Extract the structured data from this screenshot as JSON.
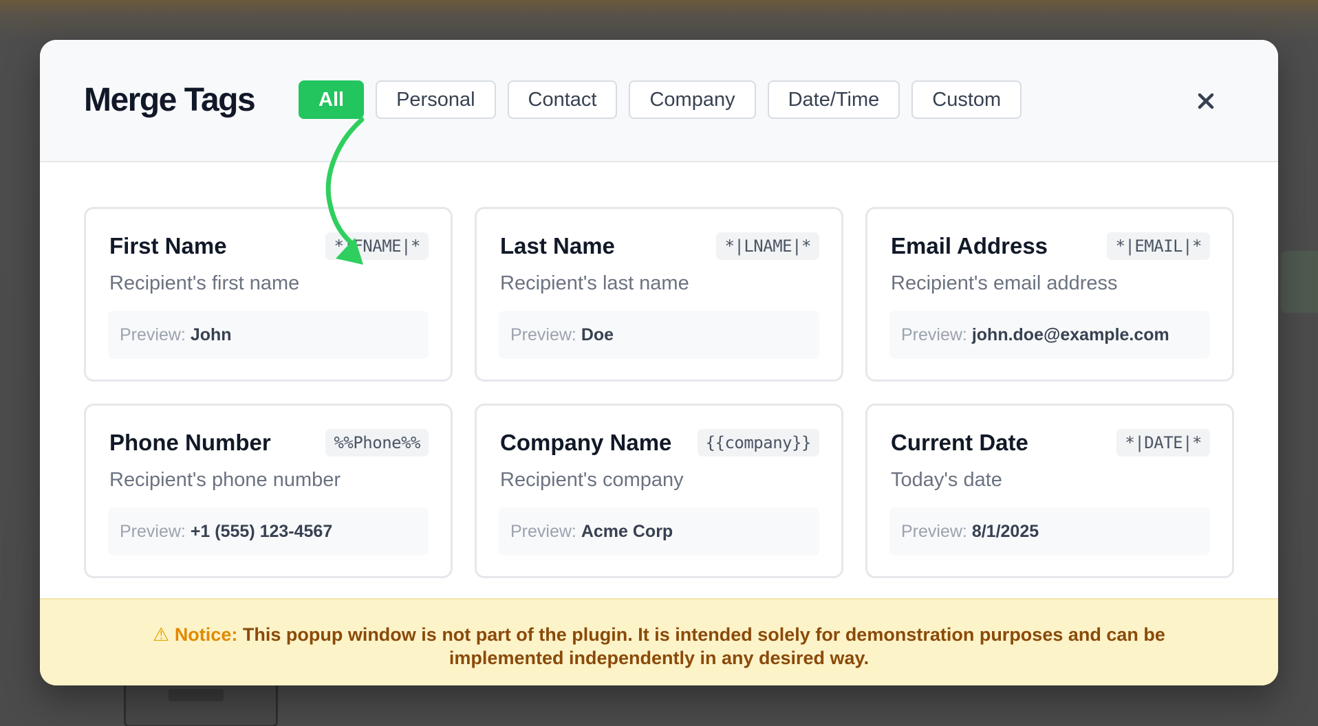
{
  "modal": {
    "title": "Merge Tags",
    "close_glyph": "×"
  },
  "tabs": [
    {
      "label": "All",
      "active": true
    },
    {
      "label": "Personal",
      "active": false
    },
    {
      "label": "Contact",
      "active": false
    },
    {
      "label": "Company",
      "active": false
    },
    {
      "label": "Date/Time",
      "active": false
    },
    {
      "label": "Custom",
      "active": false
    }
  ],
  "preview_label": "Preview:",
  "cards": [
    {
      "title": "First Name",
      "tag": "*|FNAME|*",
      "description": "Recipient's first name",
      "preview": "John"
    },
    {
      "title": "Last Name",
      "tag": "*|LNAME|*",
      "description": "Recipient's last name",
      "preview": "Doe"
    },
    {
      "title": "Email Address",
      "tag": "*|EMAIL|*",
      "description": "Recipient's email address",
      "preview": "john.doe@example.com"
    },
    {
      "title": "Phone Number",
      "tag": "%%Phone%%",
      "description": "Recipient's phone number",
      "preview": "+1 (555) 123-4567"
    },
    {
      "title": "Company Name",
      "tag": "{{company}}",
      "description": "Recipient's company",
      "preview": "Acme Corp"
    },
    {
      "title": "Current Date",
      "tag": "*|DATE|*",
      "description": "Today's date",
      "preview": "8/1/2025"
    }
  ],
  "notice": {
    "icon": "⚠",
    "label": "Notice:",
    "text": "This popup window is not part of the plugin. It is intended solely for demonstration purposes and can be implemented independently in any desired way."
  },
  "colors": {
    "accent": "#22c55e",
    "notice_bg": "#fdf3c8",
    "notice_text": "#8a4a0a",
    "notice_label": "#e08a00"
  }
}
